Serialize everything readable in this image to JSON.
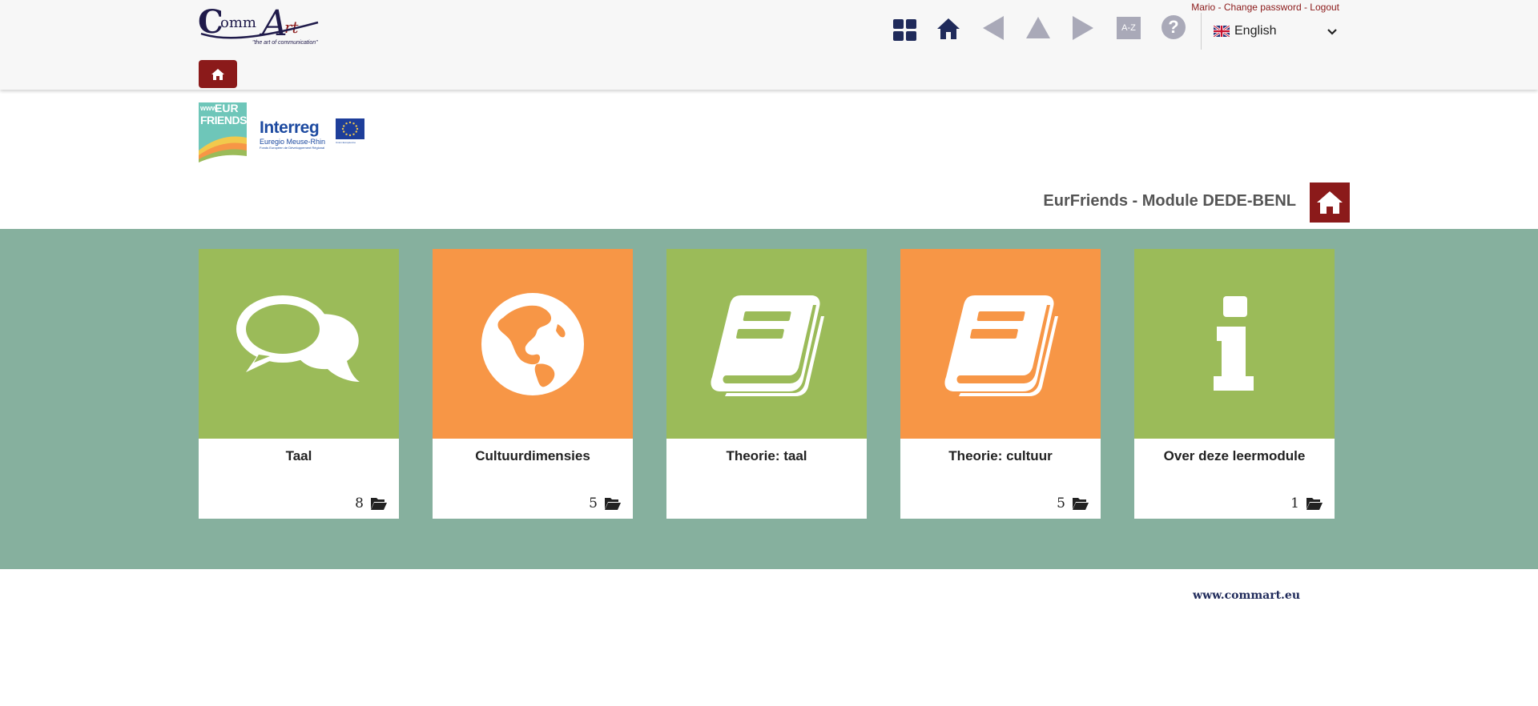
{
  "brand": {
    "logo_c": "C",
    "logo_comm": "omm",
    "logo_a": "A",
    "logo_rt": "rt",
    "logo_tagline": "\"the art of communication\""
  },
  "user_links": {
    "user": "Mario",
    "sep1": " - ",
    "change_password": "Change password",
    "sep2": " - ",
    "logout": "Logout"
  },
  "toolbar": {
    "icons": [
      "grid-icon",
      "home-icon",
      "arrow-left-icon",
      "arrow-up-icon",
      "arrow-right-icon",
      "az-icon",
      "help-icon"
    ],
    "az_label": "A-Z",
    "help_label": "?"
  },
  "language": {
    "selected": "English"
  },
  "sponsors": {
    "eurfriends_www": "www.",
    "eurfriends_eur": "EUR",
    "eurfriends_friends": "FRIENDS",
    "interreg_name": "Interreg",
    "interreg_region": "Euregio Meuse-Rhin",
    "interreg_fund": "Fonds Européen de Développement Régional",
    "eu_caption": "Union Européenne"
  },
  "module": {
    "title": "EurFriends - Module DEDE-BENL"
  },
  "cards": [
    {
      "label": "Taal",
      "count": "8",
      "color": "#9bbb59",
      "icon": "speech-bubbles-icon"
    },
    {
      "label": "Cultuurdimensies",
      "count": "5",
      "color": "#f79646",
      "icon": "globe-icon"
    },
    {
      "label": "Theorie: taal",
      "count": "",
      "color": "#9bbb59",
      "icon": "book-icon"
    },
    {
      "label": "Theorie: cultuur",
      "count": "5",
      "color": "#f79646",
      "icon": "book-icon"
    },
    {
      "label": "Over deze leermodule",
      "count": "1",
      "color": "#9bbb59",
      "icon": "info-icon"
    }
  ],
  "colors": {
    "accent": "#8b1a1a",
    "band": "#86b09e",
    "green": "#9bbb59",
    "orange": "#f79646"
  },
  "footer": {
    "link": "www.commart.eu"
  }
}
